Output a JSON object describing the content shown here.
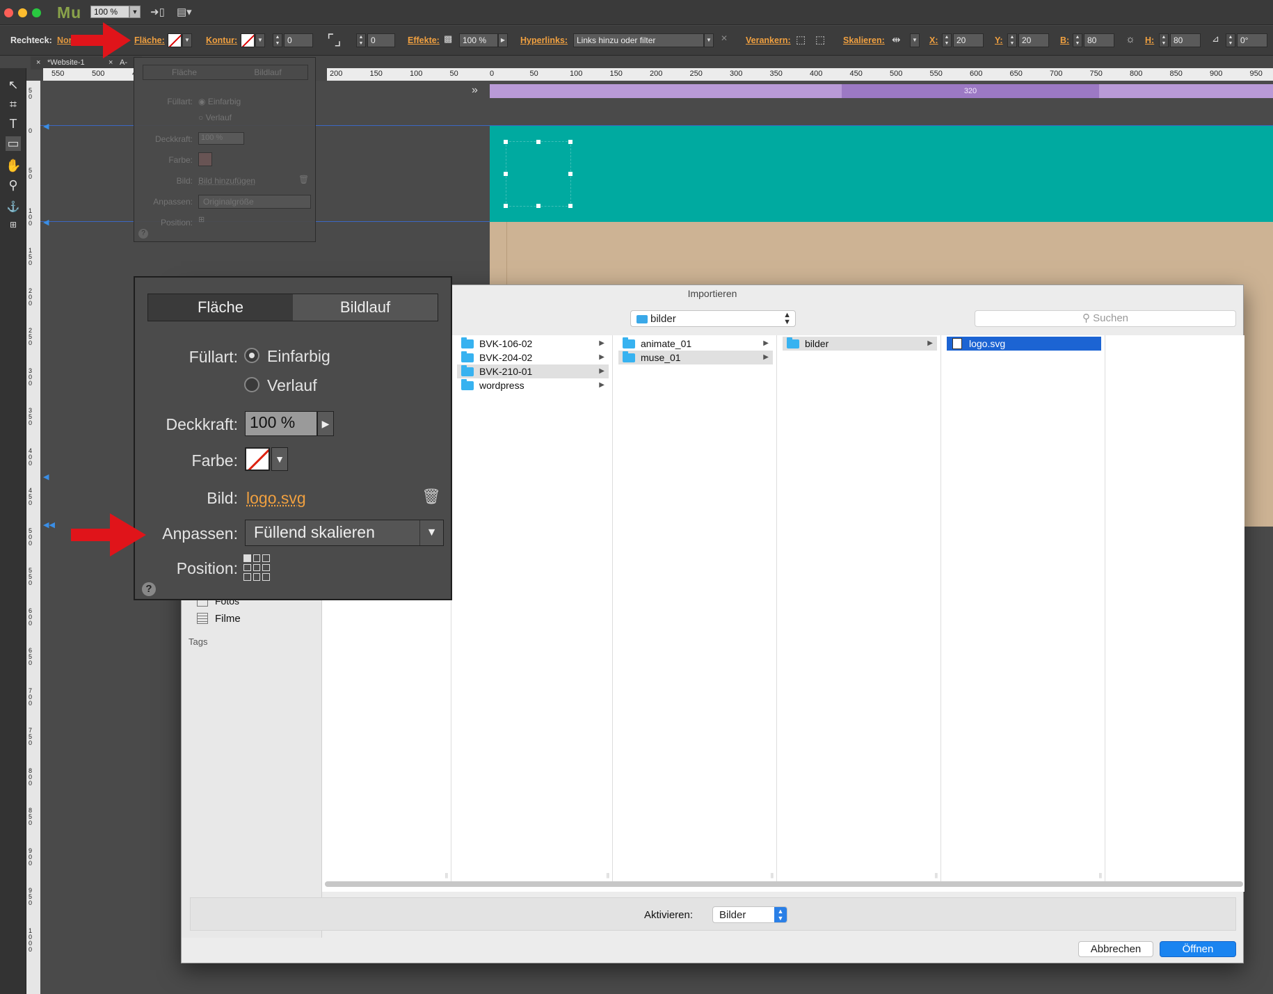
{
  "app": {
    "logo": "Mu",
    "zoom_value": "100 %"
  },
  "controlbar": {
    "object_label": "Rechteck:",
    "object_state": "Normal",
    "flaeche_label": "Fläche:",
    "kontur_label": "Kontur:",
    "kontur_value": "0",
    "corner_value": "0",
    "effekte_label": "Effekte:",
    "effekte_value": "100 %",
    "hyperlinks_label": "Hyperlinks:",
    "hyperlinks_value": "Links hinzu oder filter",
    "verankern_label": "Verankern:",
    "skalieren_label": "Skalieren:",
    "x_label": "X:",
    "x_value": "20",
    "y_label": "Y:",
    "y_value": "20",
    "b_label": "B:",
    "b_value": "80",
    "h_label": "H:",
    "h_value": "80",
    "rotation_value": "0°"
  },
  "tabs": {
    "doc_tab": "*Website-1",
    "second_tab": "A-"
  },
  "ruler": {
    "left_ticks": [
      "550",
      "500",
      "4"
    ],
    "right_ticks": [
      "200",
      "150",
      "100",
      "50",
      "0",
      "50",
      "100",
      "150",
      "200",
      "250",
      "300",
      "350",
      "400",
      "450",
      "500",
      "550",
      "600",
      "650",
      "700",
      "750",
      "800",
      "850",
      "900",
      "950"
    ],
    "vertical_ticks": [
      "50",
      "0",
      "50",
      "100",
      "150",
      "200",
      "250",
      "300",
      "350",
      "400",
      "450",
      "500",
      "550",
      "600",
      "650",
      "700",
      "750",
      "800",
      "850",
      "900",
      "950",
      "1000"
    ]
  },
  "breakpoint": {
    "value": "320"
  },
  "small_popup": {
    "tab_flaeche": "Fläche",
    "tab_bildlauf": "Bildlauf",
    "fuellart_label": "Füllart:",
    "option_einfarbig": "Einfarbig",
    "option_verlauf": "Verlauf",
    "deckkraft_label": "Deckkraft:",
    "deckkraft_value": "100 %",
    "farbe_label": "Farbe:",
    "bild_label": "Bild:",
    "bild_value": "Bild hinzufügen",
    "anpassen_label": "Anpassen:",
    "anpassen_value": "Originalgröße",
    "position_label": "Position:"
  },
  "dialog": {
    "title": "Importieren",
    "path": "bilder",
    "search_placeholder": "Suchen",
    "sidebar": {
      "item_fotos": "Fotos",
      "item_filme": "Filme",
      "section_tags": "Tags"
    },
    "columns": [
      {
        "items": []
      },
      {
        "items": [
          "BVK-106-02",
          "BVK-204-02",
          "BVK-210-01",
          "wordpress"
        ],
        "selected": "BVK-210-01"
      },
      {
        "items": [
          "animate_01",
          "muse_01"
        ],
        "selected": "muse_01"
      },
      {
        "items": [
          "bilder"
        ],
        "selected": "bilder"
      },
      {
        "items": [
          "logo.svg"
        ],
        "selected": "logo.svg"
      }
    ],
    "aktivieren_label": "Aktivieren:",
    "aktivieren_value": "Bilder",
    "cancel_label": "Abbrechen",
    "open_label": "Öffnen"
  },
  "big_popup": {
    "tab_flaeche": "Fläche",
    "tab_bildlauf": "Bildlauf",
    "fuellart_label": "Füllart:",
    "option_einfarbig": "Einfarbig",
    "option_verlauf": "Verlauf",
    "deckkraft_label": "Deckkraft:",
    "deckkraft_value": "100 %",
    "farbe_label": "Farbe:",
    "bild_label": "Bild:",
    "bild_value": "logo.svg",
    "anpassen_label": "Anpassen:",
    "anpassen_value": "Füllend skalieren",
    "position_label": "Position:",
    "help": "?"
  },
  "colors": {
    "accent_orange": "#f0a040",
    "header_teal": "#00aaa0",
    "body_tan": "#cdb394",
    "breakpoint_purple": "#b99ad7",
    "annotation_red": "#e0141a",
    "open_button_blue": "#1a84f0"
  },
  "icons": {
    "close": "close-icon",
    "folder": "folder-icon",
    "trash": "trash-icon",
    "help": "help-icon",
    "arrow": "red-annotation-arrow"
  }
}
